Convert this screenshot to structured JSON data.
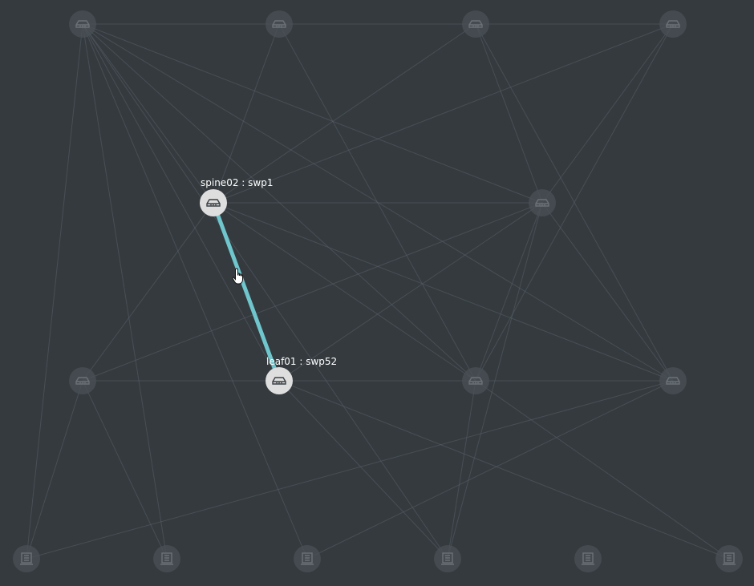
{
  "hover": {
    "source_label": "spine02 : swp1",
    "target_label": "leaf01 : swp52"
  },
  "colors": {
    "background": "#343a3e",
    "edge": "#59606a",
    "active_edge": "#6fc6cd",
    "inactive_node": "#4a5055",
    "active_node": "#dedede"
  },
  "icons": {
    "switch": "switch-icon",
    "server": "server-icon",
    "cursor": "hand-pointer-icon"
  }
}
